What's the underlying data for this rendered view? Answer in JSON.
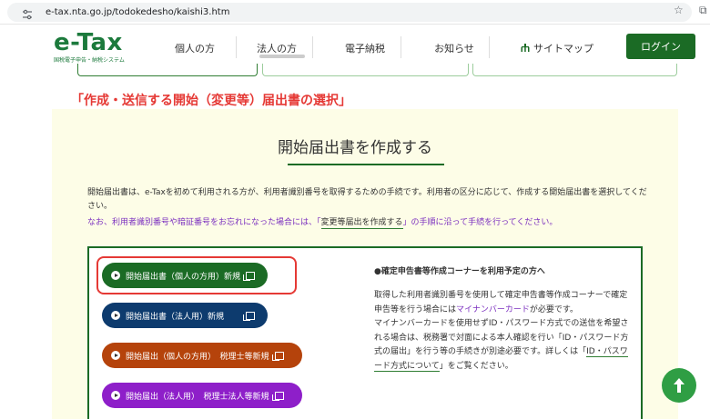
{
  "browser": {
    "url": "e-tax.nta.go.jp/todokedesho/kaishi3.htm",
    "icons": [
      "tune-icon",
      "star-icon",
      "extension-icon"
    ]
  },
  "header": {
    "logo": {
      "main": "e-Tax",
      "sub": "国税電子申告・納税システム"
    },
    "nav": [
      {
        "label": "個人の方"
      },
      {
        "label": "法人の方"
      },
      {
        "label": "電子納税"
      },
      {
        "label": "お知らせ"
      },
      {
        "label": "サイトマップ",
        "icon": "sitemap-icon"
      }
    ],
    "login_label": "ログイン"
  },
  "main": {
    "section_title": "「作成・送信する開始（変更等）届出書の選択」",
    "panel_heading": "開始届出書を作成する",
    "description": "開始届出書は、e-Taxを初めて利用される方が、利用者識別番号を取得するための手続です。利用者の区分に応じて、作成する開始届出書を選択してください。",
    "note_prefix": "なお、利用者識別番号や暗証番号をお忘れになった場合には、「",
    "note_link": "変更等届出を作成する",
    "note_suffix": "」の手順に沿って手続を行ってください。",
    "buttons": [
      {
        "label": "開始届出書（個人の方用）新規",
        "color": "#1b6b25"
      },
      {
        "label": "開始届出書（法人用）新規",
        "color": "#0d3b6e"
      },
      {
        "label": "開始届出（個人の方用）　税理士等新規",
        "color": "#b5430b"
      },
      {
        "label": "開始届出（法人用）　税理士法人等新規",
        "color": "#8e1fc9"
      }
    ],
    "info": {
      "title": "●確定申告書等作成コーナーを利用予定の方へ",
      "p1_a": "取得した利用者識別番号を使用して確定申告書等作成コーナーで確定申告等を行う場合には",
      "p1_link": "マイナンバーカード",
      "p1_b": "が必要です。",
      "p2_a": "マイナンバーカードを使用せずID・パスワード方式での送信を希望される場合は、税務署で対面による本人確認を行い「ID・パスワード方式の届出」を行う等の手続きが別途必要です。詳しくは「",
      "p2_link": "ID・パスワード方式について",
      "p2_b": "」をご覧ください。"
    },
    "page_top_icon": "arrow-up-icon"
  }
}
